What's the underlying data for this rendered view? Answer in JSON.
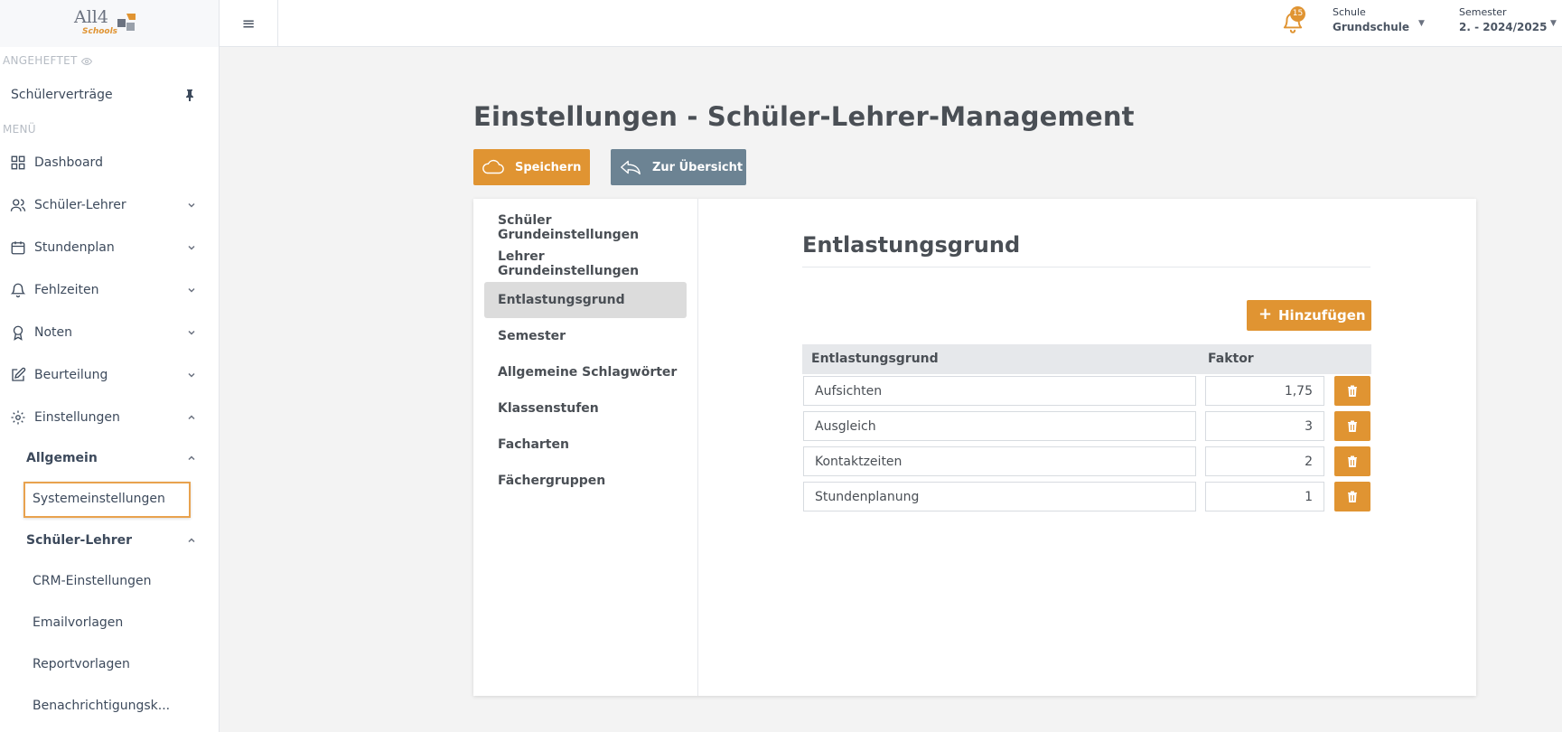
{
  "header": {
    "logo_text": "All4",
    "logo_sub": "Schools",
    "notification_count": "15",
    "school": {
      "label": "Schule",
      "value": "Grundschule"
    },
    "semester": {
      "label": "Semester",
      "value": "2. - 2024/2025"
    }
  },
  "sidebar": {
    "pinned_label": "ANGEHEFTET",
    "pinned_item": "Schülerverträge",
    "menu_label": "MENÜ",
    "items": [
      {
        "label": "Dashboard",
        "icon": "grid-icon"
      },
      {
        "label": "Schüler-Lehrer",
        "icon": "users-icon"
      },
      {
        "label": "Stundenplan",
        "icon": "calendar-icon"
      },
      {
        "label": "Fehlzeiten",
        "icon": "bell-icon"
      },
      {
        "label": "Noten",
        "icon": "award-icon"
      },
      {
        "label": "Beurteilung",
        "icon": "edit-icon"
      },
      {
        "label": "Einstellungen",
        "icon": "gear-icon"
      }
    ],
    "group_allgemein": "Allgemein",
    "systemeinstellungen": "Systemeinstellungen",
    "group_schueler_lehrer": "Schüler-Lehrer",
    "sub_items": [
      "CRM-Einstellungen",
      "Emailvorlagen",
      "Reportvorlagen",
      "Benachrichtigungsk..."
    ]
  },
  "main": {
    "title": "Einstellungen - Schüler-Lehrer-Management",
    "save_label": "Speichern",
    "back_label": "Zur Übersicht",
    "tabs": [
      "Schüler Grundeinstellungen",
      "Lehrer Grundeinstellungen",
      "Entlastungsgrund",
      "Semester",
      "Allgemeine Schlagwörter",
      "Klassenstufen",
      "Facharten",
      "Fächergruppen"
    ],
    "section_title": "Entlastungsgrund",
    "add_label": "Hinzufügen",
    "columns": [
      "Entlastungsgrund",
      "Faktor"
    ],
    "rows": [
      {
        "name": "Aufsichten",
        "factor": "1,75"
      },
      {
        "name": "Ausgleich",
        "factor": "3"
      },
      {
        "name": "Kontaktzeiten",
        "factor": "2"
      },
      {
        "name": "Stundenplanung",
        "factor": "1"
      }
    ]
  },
  "colors": {
    "accent": "#e09432",
    "secondary": "#6c8393",
    "text": "#4a4f55"
  }
}
